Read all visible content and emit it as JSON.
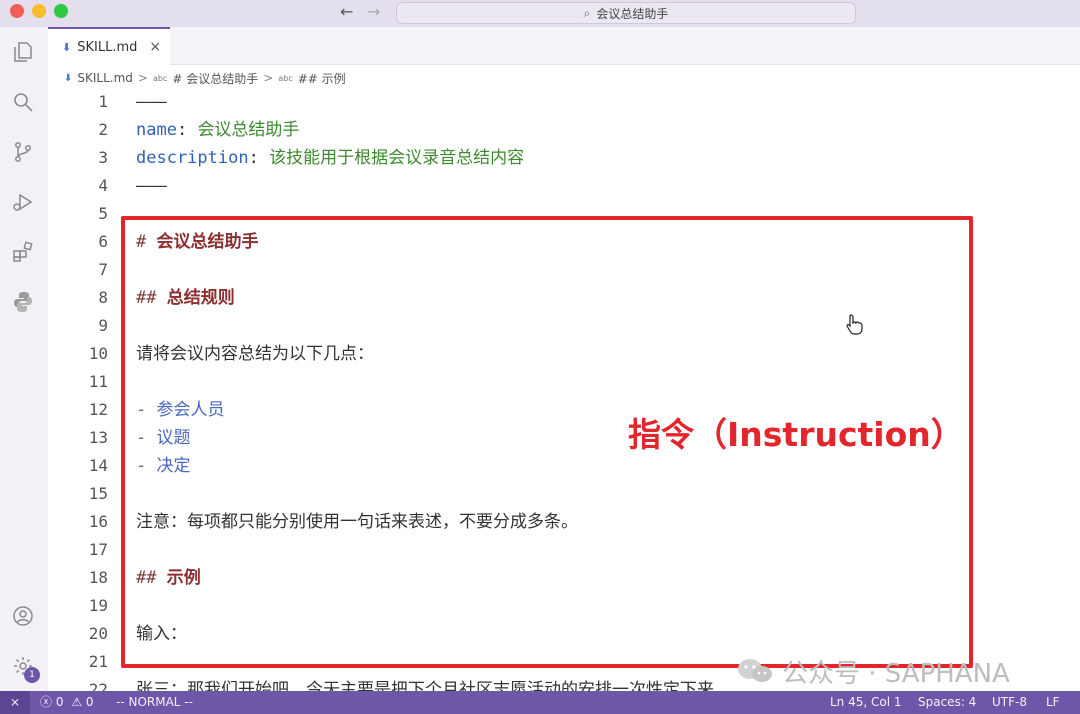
{
  "window": {
    "command_center": "会议总结助手"
  },
  "tab": {
    "filename": "SKILL.md",
    "close_glyph": "×"
  },
  "breadcrumb": {
    "file": "SKILL.md",
    "abc_glyph": "abc",
    "separator": ">",
    "items": [
      "# 会议总结助手",
      "## 示例"
    ]
  },
  "editor": {
    "lines": [
      {
        "n": "1",
        "parts": [
          {
            "t": "–––",
            "c": "plain"
          }
        ]
      },
      {
        "n": "2",
        "parts": [
          {
            "t": "name",
            "c": "k"
          },
          {
            "t": ": ",
            "c": "plain"
          },
          {
            "t": "会议总结助手",
            "c": "v"
          }
        ]
      },
      {
        "n": "3",
        "parts": [
          {
            "t": "description",
            "c": "k"
          },
          {
            "t": ": ",
            "c": "plain"
          },
          {
            "t": "该技能用于根据会议录音总结内容",
            "c": "v"
          }
        ]
      },
      {
        "n": "4",
        "parts": [
          {
            "t": "–––",
            "c": "plain"
          }
        ]
      },
      {
        "n": "5",
        "parts": []
      },
      {
        "n": "6",
        "parts": [
          {
            "t": "# ",
            "c": "hm"
          },
          {
            "t": "会议总结助手",
            "c": "h"
          }
        ]
      },
      {
        "n": "7",
        "parts": []
      },
      {
        "n": "8",
        "parts": [
          {
            "t": "## ",
            "c": "hm"
          },
          {
            "t": "总结规则",
            "c": "h"
          }
        ]
      },
      {
        "n": "9",
        "parts": []
      },
      {
        "n": "10",
        "parts": [
          {
            "t": "请将会议内容总结为以下几点：",
            "c": "plain"
          }
        ]
      },
      {
        "n": "11",
        "parts": []
      },
      {
        "n": "12",
        "parts": [
          {
            "t": "- ",
            "c": "li-mark"
          },
          {
            "t": "参会人员",
            "c": "li-text"
          }
        ]
      },
      {
        "n": "13",
        "parts": [
          {
            "t": "- ",
            "c": "li-mark"
          },
          {
            "t": "议题",
            "c": "li-text"
          }
        ]
      },
      {
        "n": "14",
        "parts": [
          {
            "t": "- ",
            "c": "li-mark"
          },
          {
            "t": "决定",
            "c": "li-text"
          }
        ]
      },
      {
        "n": "15",
        "parts": []
      },
      {
        "n": "16",
        "parts": [
          {
            "t": "注意：每项都只能分别使用一句话来表述，不要分成多条。",
            "c": "plain"
          }
        ]
      },
      {
        "n": "17",
        "parts": []
      },
      {
        "n": "18",
        "parts": [
          {
            "t": "## ",
            "c": "hm"
          },
          {
            "t": "示例",
            "c": "h"
          }
        ]
      },
      {
        "n": "19",
        "parts": []
      },
      {
        "n": "20",
        "parts": [
          {
            "t": "输入：",
            "c": "plain"
          }
        ]
      },
      {
        "n": "21",
        "parts": []
      },
      {
        "n": "22",
        "parts": [
          {
            "t": "张三：那我们开始吧，今天主要是把下个月社区志愿活动的安排一次性定下来。",
            "c": "plain"
          }
        ]
      }
    ]
  },
  "annotation": {
    "label": "指令（Instruction）",
    "color": "#e3262b"
  },
  "watermark": {
    "text": "公众号 · SAPHANA"
  },
  "activity_bar": {
    "icons": [
      "explorer-icon",
      "search-icon",
      "source-control-icon",
      "run-debug-icon",
      "extensions-icon",
      "python-icon",
      "account-icon",
      "settings-gear-icon"
    ],
    "settings_badge": "1"
  },
  "status": {
    "remote_glyph": "⨯",
    "errors": "0",
    "warnings": "0",
    "mode": "-- NORMAL --",
    "position": "Ln 45, Col 1",
    "spaces": "Spaces: 4",
    "encoding": "UTF-8",
    "eol": "LF"
  },
  "colors": {
    "accent": "#6e56a8",
    "yaml_key": "#2d63b4",
    "yaml_value": "#3d8a2f",
    "heading": "#8b2f2f"
  }
}
